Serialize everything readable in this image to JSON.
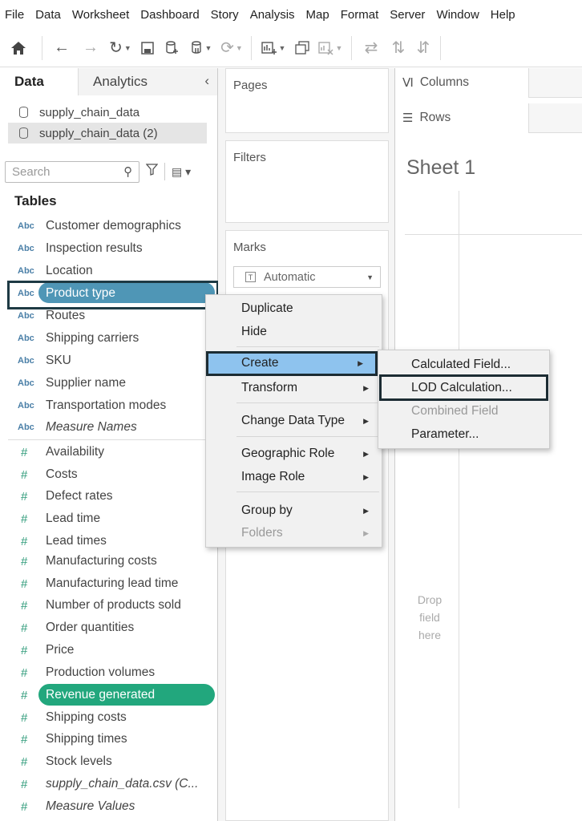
{
  "menubar": [
    "File",
    "Data",
    "Worksheet",
    "Dashboard",
    "Story",
    "Analysis",
    "Map",
    "Format",
    "Server",
    "Window",
    "Help"
  ],
  "data_pane": {
    "tab_data": "Data",
    "tab_analytics": "Analytics",
    "datasources": [
      "supply_chain_data",
      "supply_chain_data (2)"
    ],
    "search_placeholder": "Search",
    "tables_title": "Tables",
    "dimensions": [
      {
        "label": "Customer demographics",
        "type": "Abc"
      },
      {
        "label": "Inspection results",
        "type": "Abc"
      },
      {
        "label": "Location",
        "type": "Abc"
      },
      {
        "label": "Product type",
        "type": "Abc"
      },
      {
        "label": "Routes",
        "type": "Abc"
      },
      {
        "label": "Shipping carriers",
        "type": "Abc"
      },
      {
        "label": "SKU",
        "type": "Abc"
      },
      {
        "label": "Supplier name",
        "type": "Abc"
      },
      {
        "label": "Transportation modes",
        "type": "Abc"
      },
      {
        "label": "Measure Names",
        "type": "Abc"
      }
    ],
    "measures": [
      {
        "label": "Availability",
        "type": "#"
      },
      {
        "label": "Costs",
        "type": "#"
      },
      {
        "label": "Defect rates",
        "type": "#"
      },
      {
        "label": "Lead time",
        "type": "#"
      },
      {
        "label": "Lead times",
        "type": "#"
      },
      {
        "label": "Manufacturing costs",
        "type": "#"
      },
      {
        "label": "Manufacturing lead time",
        "type": "#"
      },
      {
        "label": "Number of products sold",
        "type": "#"
      },
      {
        "label": "Order quantities",
        "type": "#"
      },
      {
        "label": "Price",
        "type": "#"
      },
      {
        "label": "Production volumes",
        "type": "#"
      },
      {
        "label": "Revenue generated",
        "type": "#"
      },
      {
        "label": "Shipping costs",
        "type": "#"
      },
      {
        "label": "Shipping times",
        "type": "#"
      },
      {
        "label": "Stock levels",
        "type": "#"
      },
      {
        "label": "supply_chain_data.csv (C...",
        "type": "#"
      },
      {
        "label": "Measure Values",
        "type": "#"
      }
    ]
  },
  "shelves": {
    "pages": "Pages",
    "filters": "Filters",
    "marks": "Marks",
    "marks_type": "Automatic",
    "columns": "Columns",
    "rows": "Rows"
  },
  "sheet": {
    "title": "Sheet 1",
    "drop_hint": [
      "Drop",
      "field",
      "here"
    ]
  },
  "context_menu": {
    "items": [
      "Duplicate",
      "Hide",
      "Create",
      "Transform",
      "Change Data Type",
      "Geographic Role",
      "Image Role",
      "Group by",
      "Folders"
    ]
  },
  "create_submenu": {
    "items": [
      "Calculated Field...",
      "LOD Calculation...",
      "Combined Field",
      "Parameter..."
    ]
  },
  "colors": {
    "dimension_pill": "#4f96b6",
    "measure_pill": "#22a77d",
    "menu_highlight": "#8ec3ee"
  }
}
